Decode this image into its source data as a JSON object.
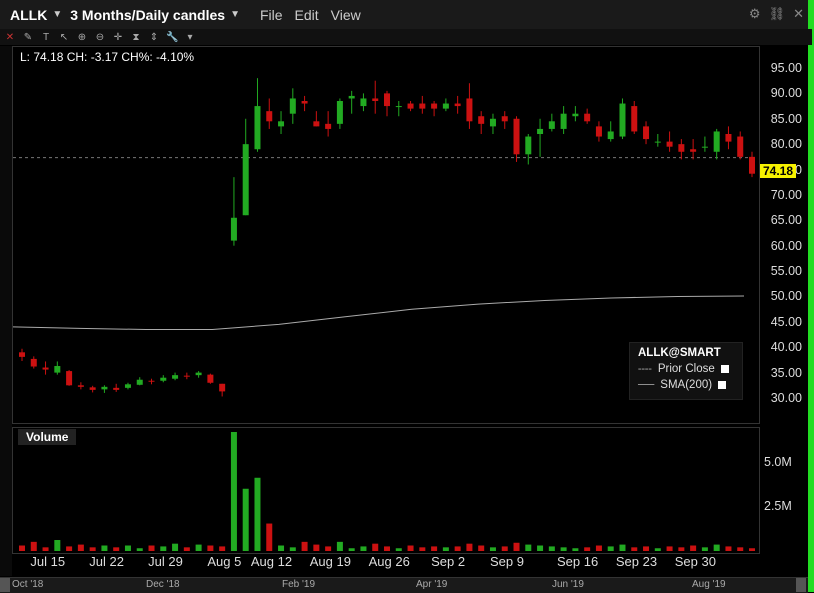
{
  "titlebar": {
    "symbol": "ALLK",
    "period": "3 Months/Daily candles",
    "menu": [
      "File",
      "Edit",
      "View"
    ]
  },
  "info": {
    "text": "L: 74.18 CH: -3.17 CH%: -4.10%"
  },
  "price": {
    "last_label": "74.18"
  },
  "legend": {
    "title": "ALLK@SMART",
    "prior_close": "Prior Close",
    "sma": "SMA(200)"
  },
  "volume": {
    "label": "Volume",
    "ticks": [
      "5.0M",
      "2.5M"
    ]
  },
  "colors": {
    "up": "#22aa22",
    "down": "#cc1111",
    "tag": "#f7f200",
    "accent": "#22dd22"
  },
  "chart_data": {
    "type": "candlestick",
    "title": "",
    "y_ticks": [
      "95.00",
      "90.00",
      "85.00",
      "80.00",
      "75.00",
      "70.00",
      "65.00",
      "60.00",
      "55.00",
      "50.00",
      "45.00",
      "40.00",
      "35.00",
      "30.00"
    ],
    "ylim": [
      27,
      98
    ],
    "x_ticks": [
      "Jul 15",
      "Jul 22",
      "Jul 29",
      "Aug 5",
      "Aug 12",
      "Aug 19",
      "Aug 26",
      "Sep 2",
      "Sep 9",
      "Sep 16",
      "Sep 23",
      "Sep 30"
    ],
    "prior_close": 77.35,
    "sma200": [
      44.0,
      43.7,
      43.5,
      43.5,
      44.5,
      46.0,
      47.5,
      48.5,
      49.2,
      49.7,
      50.0,
      50.1
    ],
    "candles": [
      {
        "o": 39.0,
        "h": 39.7,
        "l": 37.3,
        "c": 38.1
      },
      {
        "o": 37.7,
        "h": 38.2,
        "l": 35.8,
        "c": 36.2
      },
      {
        "o": 36.0,
        "h": 37.2,
        "l": 34.6,
        "c": 35.6
      },
      {
        "o": 35.0,
        "h": 37.2,
        "l": 34.6,
        "c": 36.3
      },
      {
        "o": 35.3,
        "h": 35.5,
        "l": 32.4,
        "c": 32.5
      },
      {
        "o": 32.5,
        "h": 33.1,
        "l": 31.7,
        "c": 32.2
      },
      {
        "o": 32.1,
        "h": 32.4,
        "l": 31.1,
        "c": 31.6
      },
      {
        "o": 31.7,
        "h": 32.5,
        "l": 31.0,
        "c": 32.2
      },
      {
        "o": 32.0,
        "h": 32.8,
        "l": 31.2,
        "c": 31.6
      },
      {
        "o": 32.0,
        "h": 33.0,
        "l": 31.7,
        "c": 32.7
      },
      {
        "o": 32.6,
        "h": 34.1,
        "l": 32.5,
        "c": 33.6
      },
      {
        "o": 33.4,
        "h": 33.8,
        "l": 32.7,
        "c": 33.3
      },
      {
        "o": 33.4,
        "h": 34.5,
        "l": 33.1,
        "c": 34.0
      },
      {
        "o": 33.8,
        "h": 35.0,
        "l": 33.5,
        "c": 34.5
      },
      {
        "o": 34.4,
        "h": 35.0,
        "l": 33.7,
        "c": 34.2
      },
      {
        "o": 34.5,
        "h": 35.3,
        "l": 34.0,
        "c": 35.0
      },
      {
        "o": 34.6,
        "h": 34.8,
        "l": 32.8,
        "c": 33.0
      },
      {
        "o": 32.8,
        "h": 32.8,
        "l": 30.3,
        "c": 31.3
      },
      {
        "o": 61.0,
        "h": 73.5,
        "l": 60.0,
        "c": 65.5
      },
      {
        "o": 66.0,
        "h": 85.0,
        "l": 66.0,
        "c": 80.0
      },
      {
        "o": 79.0,
        "h": 93.0,
        "l": 78.5,
        "c": 87.5
      },
      {
        "o": 86.5,
        "h": 89.0,
        "l": 83.0,
        "c": 84.5
      },
      {
        "o": 83.5,
        "h": 86.5,
        "l": 82.0,
        "c": 84.5
      },
      {
        "o": 86.0,
        "h": 91.0,
        "l": 84.0,
        "c": 89.0
      },
      {
        "o": 88.5,
        "h": 89.5,
        "l": 86.5,
        "c": 88.0
      },
      {
        "o": 84.5,
        "h": 86.5,
        "l": 83.5,
        "c": 83.5
      },
      {
        "o": 84.0,
        "h": 86.5,
        "l": 81.5,
        "c": 83.0
      },
      {
        "o": 84.0,
        "h": 89.0,
        "l": 83.0,
        "c": 88.5
      },
      {
        "o": 89.0,
        "h": 90.5,
        "l": 86.0,
        "c": 89.5
      },
      {
        "o": 87.5,
        "h": 90.0,
        "l": 86.5,
        "c": 89.0
      },
      {
        "o": 89.0,
        "h": 92.5,
        "l": 86.0,
        "c": 88.5
      },
      {
        "o": 90.0,
        "h": 90.5,
        "l": 85.5,
        "c": 87.5
      },
      {
        "o": 87.5,
        "h": 88.5,
        "l": 85.5,
        "c": 87.5
      },
      {
        "o": 88.0,
        "h": 88.5,
        "l": 86.5,
        "c": 87.0
      },
      {
        "o": 88.0,
        "h": 89.5,
        "l": 86.0,
        "c": 87.0
      },
      {
        "o": 88.0,
        "h": 88.5,
        "l": 85.5,
        "c": 87.0
      },
      {
        "o": 87.0,
        "h": 89.0,
        "l": 86.5,
        "c": 88.0
      },
      {
        "o": 88.0,
        "h": 89.5,
        "l": 86.0,
        "c": 87.5
      },
      {
        "o": 89.0,
        "h": 92.0,
        "l": 83.0,
        "c": 84.5
      },
      {
        "o": 85.5,
        "h": 86.5,
        "l": 82.0,
        "c": 84.0
      },
      {
        "o": 83.5,
        "h": 86.0,
        "l": 82.0,
        "c": 85.0
      },
      {
        "o": 85.5,
        "h": 86.5,
        "l": 83.0,
        "c": 84.5
      },
      {
        "o": 85.0,
        "h": 85.5,
        "l": 76.5,
        "c": 78.0
      },
      {
        "o": 78.0,
        "h": 82.0,
        "l": 76.0,
        "c": 81.5
      },
      {
        "o": 82.0,
        "h": 85.0,
        "l": 77.5,
        "c": 83.0
      },
      {
        "o": 83.0,
        "h": 86.0,
        "l": 82.5,
        "c": 84.5
      },
      {
        "o": 83.0,
        "h": 87.5,
        "l": 82.0,
        "c": 86.0
      },
      {
        "o": 85.5,
        "h": 87.5,
        "l": 84.5,
        "c": 86.0
      },
      {
        "o": 86.0,
        "h": 87.0,
        "l": 84.0,
        "c": 84.5
      },
      {
        "o": 83.5,
        "h": 84.5,
        "l": 80.5,
        "c": 81.5
      },
      {
        "o": 81.0,
        "h": 84.5,
        "l": 80.5,
        "c": 82.5
      },
      {
        "o": 81.5,
        "h": 89.0,
        "l": 81.0,
        "c": 88.0
      },
      {
        "o": 87.5,
        "h": 88.5,
        "l": 82.0,
        "c": 82.5
      },
      {
        "o": 83.5,
        "h": 84.5,
        "l": 80.0,
        "c": 81.0
      },
      {
        "o": 80.5,
        "h": 82.0,
        "l": 79.5,
        "c": 80.5
      },
      {
        "o": 80.5,
        "h": 82.5,
        "l": 78.5,
        "c": 79.5
      },
      {
        "o": 80.0,
        "h": 81.0,
        "l": 77.0,
        "c": 78.5
      },
      {
        "o": 79.0,
        "h": 81.0,
        "l": 77.0,
        "c": 78.5
      },
      {
        "o": 79.5,
        "h": 81.5,
        "l": 78.5,
        "c": 79.5
      },
      {
        "o": 78.5,
        "h": 83.0,
        "l": 77.0,
        "c": 82.5
      },
      {
        "o": 82.0,
        "h": 83.5,
        "l": 79.0,
        "c": 80.5
      },
      {
        "o": 81.5,
        "h": 82.5,
        "l": 77.0,
        "c": 77.5
      },
      {
        "o": 77.5,
        "h": 78.5,
        "l": 73.5,
        "c": 74.18
      }
    ],
    "volume_ylim": [
      0,
      6500000
    ],
    "volume": [
      300000,
      500000,
      200000,
      600000,
      250000,
      350000,
      200000,
      300000,
      200000,
      300000,
      150000,
      300000,
      250000,
      400000,
      200000,
      350000,
      300000,
      250000,
      6500000,
      3400000,
      4000000,
      1500000,
      300000,
      200000,
      500000,
      350000,
      250000,
      500000,
      150000,
      250000,
      400000,
      250000,
      150000,
      300000,
      200000,
      250000,
      200000,
      250000,
      400000,
      300000,
      200000,
      250000,
      450000,
      350000,
      300000,
      250000,
      200000,
      150000,
      200000,
      300000,
      250000,
      350000,
      200000,
      250000,
      150000,
      250000,
      200000,
      300000,
      200000,
      350000,
      250000,
      200000,
      150000
    ]
  },
  "nav": {
    "labels": [
      "Oct '18",
      "Dec '18",
      "Feb '19",
      "Apr '19",
      "Jun '19",
      "Aug '19"
    ]
  }
}
